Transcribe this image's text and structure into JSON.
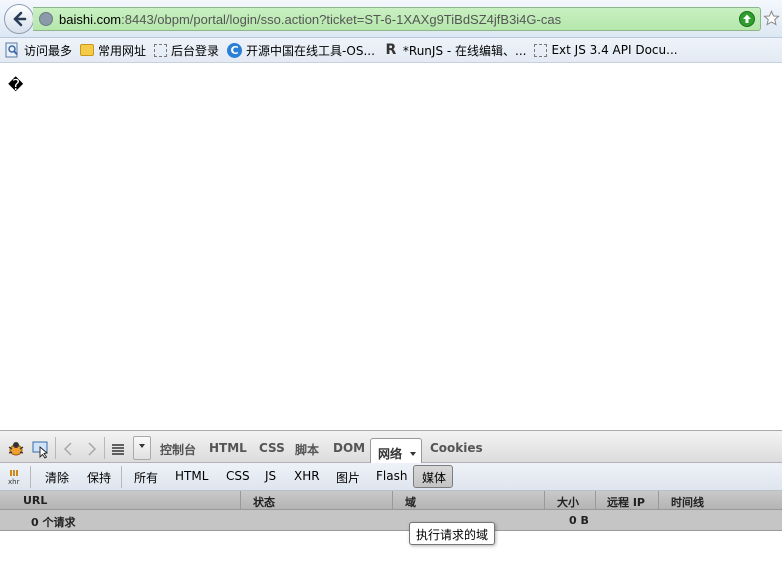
{
  "browser": {
    "url_host": "baishi.com",
    "url_rest": ":8443/obpm/portal/login/sso.action?ticket=ST-6-1XAXg9TiBdSZ4jfB3i4G-cas",
    "bookmarks": [
      {
        "label": "访问最多",
        "icon": "search-page-icon"
      },
      {
        "label": "常用网址",
        "icon": "folder-icon"
      },
      {
        "label": "后台登录",
        "icon": "page-placeholder-icon"
      },
      {
        "label": "开源中国在线工具-OS...",
        "icon": "oschina-icon"
      },
      {
        "label": "*RunJS - 在线编辑、...",
        "icon": "runjs-icon"
      },
      {
        "label": "Ext JS 3.4 API Docu...",
        "icon": "page-placeholder-icon"
      }
    ]
  },
  "page": {
    "content_char": "�"
  },
  "firebug": {
    "tabs": [
      "控制台",
      "HTML",
      "CSS",
      "脚本",
      "DOM",
      "网络",
      "Cookies"
    ],
    "active_tab": "网络",
    "filters": [
      "清除",
      "保持",
      "所有",
      "HTML",
      "CSS",
      "JS",
      "XHR",
      "图片",
      "Flash",
      "媒体"
    ],
    "active_filter": "媒体",
    "columns": [
      "URL",
      "状态",
      "域",
      "大小",
      "远程 IP",
      "时间线"
    ],
    "summary": {
      "requests": "0 个请求",
      "size": "0 B"
    },
    "tooltip": "执行请求的域"
  }
}
